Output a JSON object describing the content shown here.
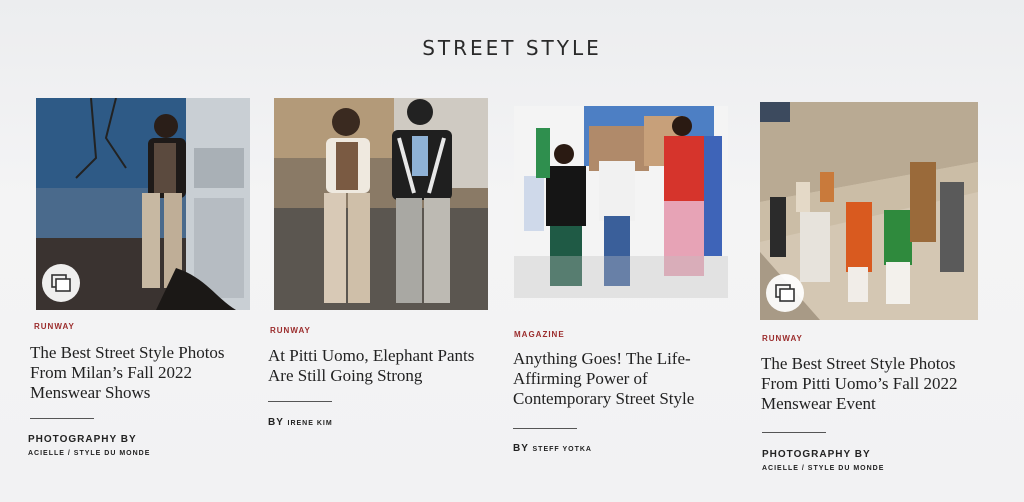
{
  "section": {
    "title": "STREET STYLE"
  },
  "cards": [
    {
      "tag": "RUNWAY",
      "headline": "The Best Street Style Photos From Milan’s Fall 2022 Menswear Shows",
      "byline_label": "PHOTOGRAPHY BY",
      "credit": "ACIELLE / STYLE DU MONDE",
      "gallery": true,
      "accent": "#9b2c2c"
    },
    {
      "tag": "RUNWAY",
      "headline": "At Pitti Uomo, Elephant Pants Are Still Going Strong",
      "byline_label": "BY",
      "credit": "IRENE KIM",
      "gallery": false
    },
    {
      "tag": "MAGAZINE",
      "headline": "Anything Goes! The Life-Affirming Power of Contemporary Street Style",
      "byline_label": "BY",
      "credit": "STEFF YOTKA",
      "gallery": false
    },
    {
      "tag": "RUNWAY",
      "headline": "The Best Street Style Photos From Pitti Uomo’s Fall 2022 Menswear Event",
      "byline_label": "PHOTOGRAPHY BY",
      "credit": "ACIELLE / STYLE DU MONDE",
      "gallery": true
    }
  ],
  "icons": {
    "gallery": "gallery-icon"
  }
}
